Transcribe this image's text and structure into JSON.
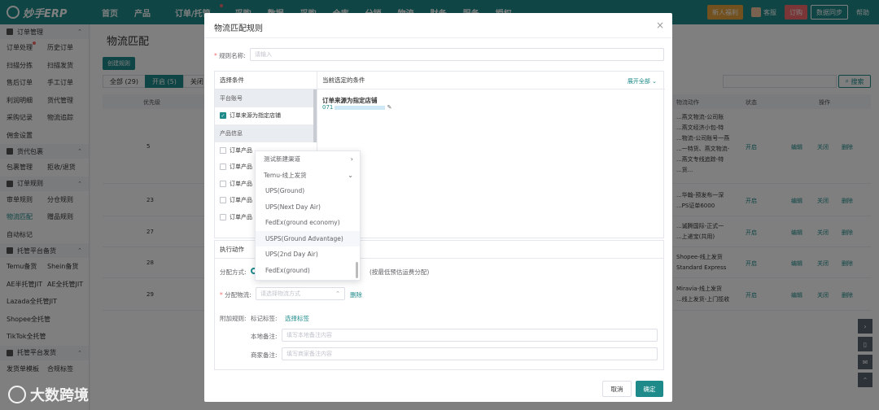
{
  "topbar": {
    "logo": "妙手ERP",
    "nav": [
      "首页",
      "产品",
      "订单/托管",
      "采购",
      "数据",
      "采购",
      "仓库",
      "分销",
      "物流",
      "财务",
      "服务",
      "授权"
    ],
    "buttons": [
      "新人福利",
      "客服",
      "订购",
      "数据同步",
      "帮助"
    ]
  },
  "sidebar": {
    "groups": [
      {
        "label": "订单管理",
        "rows": [
          [
            "订单处理",
            "历史订单"
          ],
          [
            "扫描分拣",
            "扫描发货"
          ],
          [
            "售后订单",
            "手工订单"
          ],
          [
            "利润明细",
            "货代管理"
          ],
          [
            "采购记录",
            "物流追踪"
          ],
          [
            "佣金设置",
            ""
          ]
        ]
      },
      {
        "label": "货代包裹",
        "rows": [
          [
            "包裹管理",
            "拒收/退货"
          ]
        ]
      },
      {
        "label": "订单规则",
        "rows": [
          [
            "审单规则",
            "分仓规则"
          ],
          [
            "物流匹配",
            "赠品规则"
          ],
          [
            "自动标记",
            ""
          ]
        ]
      },
      {
        "label": "托管平台备货",
        "rows": [
          [
            "Temu备货",
            "Shein备货"
          ],
          [
            "AE半托管JIT",
            "AE全托管JIT"
          ],
          [
            "Lazada全托管JIT",
            ""
          ],
          [
            "Shopee全托管",
            ""
          ],
          [
            "TikTok全托管",
            ""
          ]
        ]
      },
      {
        "label": "托管平台发货",
        "rows": [
          [
            "发货单模板",
            "合规标签"
          ]
        ]
      }
    ]
  },
  "main": {
    "title": "物流匹配",
    "create": "创建规则",
    "tabs": [
      "全部 (29)",
      "开启 (5)",
      "关闭"
    ],
    "search": "搜索",
    "headers": [
      "优先级",
      "物流动作",
      "状态",
      "操作"
    ],
    "rows": [
      {
        "priority": "5",
        "action": [
          "...燕文物流-公司账",
          "...燕文经济小包-特",
          "...物流-公司账号一燕",
          "...一特货、燕文物流-",
          "...燕文专线追踪-特",
          "...货..."
        ],
        "status": "开启",
        "ops": [
          "编辑",
          "关闭",
          "删除"
        ]
      },
      {
        "priority": "23",
        "action": [
          "...华翰-预发布一深",
          "...PS证单6000"
        ],
        "status": "开启",
        "ops": [
          "编辑",
          "关闭",
          "删除"
        ]
      },
      {
        "priority": "27",
        "action": [
          "...诚腾国际-正式一",
          "...上递宝(共用)"
        ],
        "status": "开启",
        "ops": [
          "编辑",
          "关闭",
          "删除"
        ]
      },
      {
        "priority": "28",
        "action": [
          "Shopee-线上发货",
          "Standard Express"
        ],
        "status": "开启",
        "ops": [
          "编辑",
          "关闭",
          "删除"
        ]
      },
      {
        "priority": "29",
        "action": [
          "Miravia-线上发货",
          "...线上发货-上门揽收"
        ],
        "status": "开启",
        "ops": [
          "编辑",
          "关闭",
          "删除"
        ]
      }
    ]
  },
  "modal": {
    "title": "物流匹配规则",
    "name_label": "规则名称:",
    "name_placeholder": "请输入",
    "select_title": "选择条件",
    "current_title": "当前选定的条件",
    "expand_all": "展开全部",
    "group1": "平台账号",
    "item_checked": "订单来源为指定店铺",
    "group2": "产品信息",
    "product_items": [
      "订单产品",
      "订单产品",
      "订单产品",
      "订单产品",
      "订单产品"
    ],
    "cond_title": "订单来源为指定店铺",
    "cond_value": "071",
    "exec_title": "执行动作",
    "assign_label": "分配方式:",
    "assign_note": "(按最低预估运费分配)",
    "logistics_label": "分配物流:",
    "logistics_placeholder": "请选择物流方式",
    "delete": "删除",
    "extra_label": "附加规则:",
    "tag_label": "标记标签:",
    "tag_link": "选择标签",
    "local_label": "本地备注:",
    "local_placeholder": "填写本地备注内容",
    "merchant_label": "商家备注:",
    "merchant_placeholder": "填写商家备注内容",
    "cancel": "取消",
    "ok": "确定"
  },
  "dropdown": {
    "items": [
      {
        "label": "测试新建渠道",
        "arrow": "›"
      },
      {
        "label": "Temu-线上发货",
        "arrow": "⌄"
      },
      {
        "label": "UPS(Ground)"
      },
      {
        "label": "UPS(Next Day Air)"
      },
      {
        "label": "FedEx(ground economy)"
      },
      {
        "label": "USPS(Ground Advantage)"
      },
      {
        "label": "UPS(2nd Day Air)"
      },
      {
        "label": "FedEx(ground)"
      }
    ]
  },
  "watermark": "大数跨境"
}
